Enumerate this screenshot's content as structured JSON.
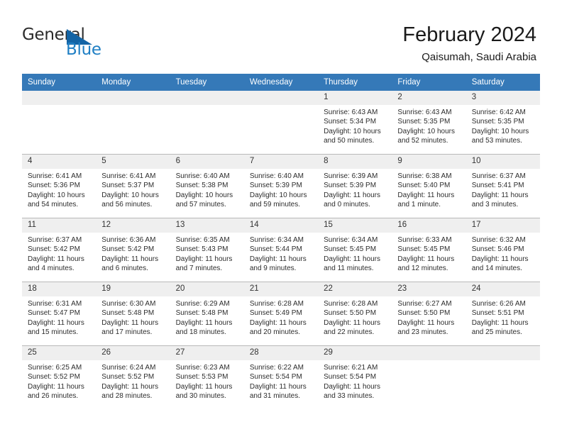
{
  "brand": {
    "name_part1": "General",
    "name_part2": "Blue",
    "triangle_icon": "blue-triangle-logo-mark",
    "accent_color": "#1f7fc4",
    "logo_mark_color": "#1464a5"
  },
  "header": {
    "title": "February 2024",
    "subtitle": "Qaisumah, Saudi Arabia"
  },
  "calendar": {
    "header_bg": "#3579b8",
    "day_band_bg": "#efefef",
    "weekday_headers": [
      "Sunday",
      "Monday",
      "Tuesday",
      "Wednesday",
      "Thursday",
      "Friday",
      "Saturday"
    ],
    "weeks": [
      [
        {
          "day": "",
          "blank": true
        },
        {
          "day": "",
          "blank": true
        },
        {
          "day": "",
          "blank": true
        },
        {
          "day": "",
          "blank": true
        },
        {
          "day": "1",
          "sunrise": "Sunrise: 6:43 AM",
          "sunset": "Sunset: 5:34 PM",
          "daylight": "Daylight: 10 hours and 50 minutes."
        },
        {
          "day": "2",
          "sunrise": "Sunrise: 6:43 AM",
          "sunset": "Sunset: 5:35 PM",
          "daylight": "Daylight: 10 hours and 52 minutes."
        },
        {
          "day": "3",
          "sunrise": "Sunrise: 6:42 AM",
          "sunset": "Sunset: 5:35 PM",
          "daylight": "Daylight: 10 hours and 53 minutes."
        }
      ],
      [
        {
          "day": "4",
          "sunrise": "Sunrise: 6:41 AM",
          "sunset": "Sunset: 5:36 PM",
          "daylight": "Daylight: 10 hours and 54 minutes."
        },
        {
          "day": "5",
          "sunrise": "Sunrise: 6:41 AM",
          "sunset": "Sunset: 5:37 PM",
          "daylight": "Daylight: 10 hours and 56 minutes."
        },
        {
          "day": "6",
          "sunrise": "Sunrise: 6:40 AM",
          "sunset": "Sunset: 5:38 PM",
          "daylight": "Daylight: 10 hours and 57 minutes."
        },
        {
          "day": "7",
          "sunrise": "Sunrise: 6:40 AM",
          "sunset": "Sunset: 5:39 PM",
          "daylight": "Daylight: 10 hours and 59 minutes."
        },
        {
          "day": "8",
          "sunrise": "Sunrise: 6:39 AM",
          "sunset": "Sunset: 5:39 PM",
          "daylight": "Daylight: 11 hours and 0 minutes."
        },
        {
          "day": "9",
          "sunrise": "Sunrise: 6:38 AM",
          "sunset": "Sunset: 5:40 PM",
          "daylight": "Daylight: 11 hours and 1 minute."
        },
        {
          "day": "10",
          "sunrise": "Sunrise: 6:37 AM",
          "sunset": "Sunset: 5:41 PM",
          "daylight": "Daylight: 11 hours and 3 minutes."
        }
      ],
      [
        {
          "day": "11",
          "sunrise": "Sunrise: 6:37 AM",
          "sunset": "Sunset: 5:42 PM",
          "daylight": "Daylight: 11 hours and 4 minutes."
        },
        {
          "day": "12",
          "sunrise": "Sunrise: 6:36 AM",
          "sunset": "Sunset: 5:42 PM",
          "daylight": "Daylight: 11 hours and 6 minutes."
        },
        {
          "day": "13",
          "sunrise": "Sunrise: 6:35 AM",
          "sunset": "Sunset: 5:43 PM",
          "daylight": "Daylight: 11 hours and 7 minutes."
        },
        {
          "day": "14",
          "sunrise": "Sunrise: 6:34 AM",
          "sunset": "Sunset: 5:44 PM",
          "daylight": "Daylight: 11 hours and 9 minutes."
        },
        {
          "day": "15",
          "sunrise": "Sunrise: 6:34 AM",
          "sunset": "Sunset: 5:45 PM",
          "daylight": "Daylight: 11 hours and 11 minutes."
        },
        {
          "day": "16",
          "sunrise": "Sunrise: 6:33 AM",
          "sunset": "Sunset: 5:45 PM",
          "daylight": "Daylight: 11 hours and 12 minutes."
        },
        {
          "day": "17",
          "sunrise": "Sunrise: 6:32 AM",
          "sunset": "Sunset: 5:46 PM",
          "daylight": "Daylight: 11 hours and 14 minutes."
        }
      ],
      [
        {
          "day": "18",
          "sunrise": "Sunrise: 6:31 AM",
          "sunset": "Sunset: 5:47 PM",
          "daylight": "Daylight: 11 hours and 15 minutes."
        },
        {
          "day": "19",
          "sunrise": "Sunrise: 6:30 AM",
          "sunset": "Sunset: 5:48 PM",
          "daylight": "Daylight: 11 hours and 17 minutes."
        },
        {
          "day": "20",
          "sunrise": "Sunrise: 6:29 AM",
          "sunset": "Sunset: 5:48 PM",
          "daylight": "Daylight: 11 hours and 18 minutes."
        },
        {
          "day": "21",
          "sunrise": "Sunrise: 6:28 AM",
          "sunset": "Sunset: 5:49 PM",
          "daylight": "Daylight: 11 hours and 20 minutes."
        },
        {
          "day": "22",
          "sunrise": "Sunrise: 6:28 AM",
          "sunset": "Sunset: 5:50 PM",
          "daylight": "Daylight: 11 hours and 22 minutes."
        },
        {
          "day": "23",
          "sunrise": "Sunrise: 6:27 AM",
          "sunset": "Sunset: 5:50 PM",
          "daylight": "Daylight: 11 hours and 23 minutes."
        },
        {
          "day": "24",
          "sunrise": "Sunrise: 6:26 AM",
          "sunset": "Sunset: 5:51 PM",
          "daylight": "Daylight: 11 hours and 25 minutes."
        }
      ],
      [
        {
          "day": "25",
          "sunrise": "Sunrise: 6:25 AM",
          "sunset": "Sunset: 5:52 PM",
          "daylight": "Daylight: 11 hours and 26 minutes."
        },
        {
          "day": "26",
          "sunrise": "Sunrise: 6:24 AM",
          "sunset": "Sunset: 5:52 PM",
          "daylight": "Daylight: 11 hours and 28 minutes."
        },
        {
          "day": "27",
          "sunrise": "Sunrise: 6:23 AM",
          "sunset": "Sunset: 5:53 PM",
          "daylight": "Daylight: 11 hours and 30 minutes."
        },
        {
          "day": "28",
          "sunrise": "Sunrise: 6:22 AM",
          "sunset": "Sunset: 5:54 PM",
          "daylight": "Daylight: 11 hours and 31 minutes."
        },
        {
          "day": "29",
          "sunrise": "Sunrise: 6:21 AM",
          "sunset": "Sunset: 5:54 PM",
          "daylight": "Daylight: 11 hours and 33 minutes."
        },
        {
          "day": "",
          "blank": true
        },
        {
          "day": "",
          "blank": true
        }
      ]
    ]
  }
}
